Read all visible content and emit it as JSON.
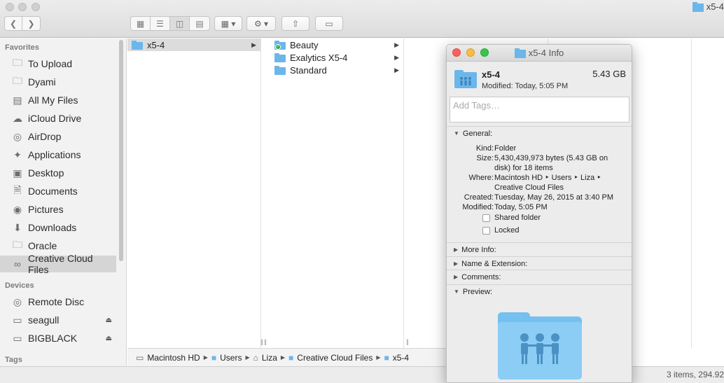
{
  "window": {
    "title": "x5-4"
  },
  "toolbar": {
    "back_icon": "chevron-left",
    "forward_icon": "chevron-right",
    "view_modes": [
      "icon-view",
      "list-view",
      "column-view",
      "cover-flow-view"
    ],
    "arrange_icon": "arrange",
    "action_icon": "gear",
    "share_icon": "share",
    "tags_icon": "tag"
  },
  "sidebar": {
    "favorites_heading": "Favorites",
    "favorites": [
      {
        "label": "To Upload",
        "icon": "folder-icon"
      },
      {
        "label": "Dyami",
        "icon": "folder-icon"
      },
      {
        "label": "All My Files",
        "icon": "all-files-icon"
      },
      {
        "label": "iCloud Drive",
        "icon": "cloud-icon"
      },
      {
        "label": "AirDrop",
        "icon": "airdrop-icon"
      },
      {
        "label": "Applications",
        "icon": "applications-icon"
      },
      {
        "label": "Desktop",
        "icon": "desktop-icon"
      },
      {
        "label": "Documents",
        "icon": "documents-icon"
      },
      {
        "label": "Pictures",
        "icon": "camera-icon"
      },
      {
        "label": "Downloads",
        "icon": "download-icon"
      },
      {
        "label": "Oracle",
        "icon": "folder-icon"
      },
      {
        "label": "Creative Cloud Files",
        "icon": "creative-cloud-icon"
      }
    ],
    "devices_heading": "Devices",
    "devices": [
      {
        "label": "Remote Disc",
        "icon": "disc-icon"
      },
      {
        "label": "seagull",
        "icon": "drive-icon"
      },
      {
        "label": "BIGBLACK",
        "icon": "drive-icon"
      }
    ],
    "tags_heading": "Tags"
  },
  "columns": {
    "first": [
      {
        "label": "x5-4"
      }
    ],
    "second": [
      {
        "label": "Beauty"
      },
      {
        "label": "Exalytics X5-4"
      },
      {
        "label": "Standard"
      }
    ]
  },
  "pathbar": {
    "items": [
      "Macintosh HD",
      "Users",
      "Liza",
      "Creative Cloud Files",
      "x5-4"
    ]
  },
  "status": {
    "text": "3 items, 294.92"
  },
  "info": {
    "title": "x5-4 Info",
    "name": "x5-4",
    "size": "5.43 GB",
    "modified_line": "Modified: Today, 5:05 PM",
    "tags_placeholder": "Add Tags…",
    "general_label": "General:",
    "kind_key": "Kind:",
    "kind_val": "Folder",
    "size_key": "Size:",
    "size_val": "5,430,439,973 bytes (5.43 GB on disk) for 18 items",
    "where_key": "Where:",
    "where_val": "Macintosh HD ‣ Users ‣ Liza ‣ Creative Cloud Files",
    "created_key": "Created:",
    "created_val": "Tuesday, May 26, 2015 at 3:40 PM",
    "modified_key": "Modified:",
    "modified_val": "Today, 5:05 PM",
    "shared_label": "Shared folder",
    "locked_label": "Locked",
    "more_info": "More Info:",
    "name_ext": "Name & Extension:",
    "comments": "Comments:",
    "preview": "Preview:"
  }
}
